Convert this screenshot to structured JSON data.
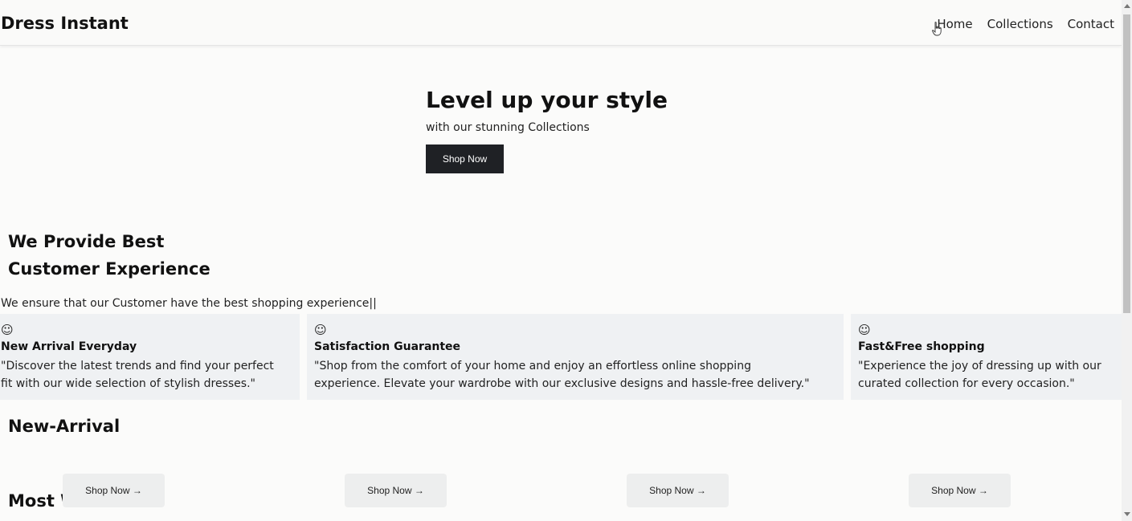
{
  "brand": "Dress Instant",
  "nav": {
    "home": "Home",
    "collections": "Collections",
    "contact": "Contact"
  },
  "hero": {
    "title": "Level up your style",
    "subtitle": "with our stunning Collections",
    "button": "Shop Now"
  },
  "experience": {
    "title_line1": "We Provide Best",
    "title_line2": "Customer Experience",
    "description": "We ensure that our Customer have the best shopping experience||"
  },
  "features": [
    {
      "icon": "☺",
      "title": "New Arrival Everyday",
      "line1": "\"Discover the latest trends and find your perfect",
      "line2": "fit with our wide selection of stylish dresses.\""
    },
    {
      "icon": "☺",
      "title": "Satisfaction Guarantee",
      "line1": "\"Shop from the comfort of your home and enjoy an effortless online shopping",
      "line2": "experience. Elevate your wardrobe with our exclusive designs and hassle-free delivery.\""
    },
    {
      "icon": "☺",
      "title": "Fast&Free shopping",
      "line1": "\"Experience the joy of dressing up with our",
      "line2": "curated collection for every occasion.\""
    }
  ],
  "new_arrival_title": "New-Arrival",
  "most_wanted_title": "Most Wanted",
  "product_buttons": [
    "Shop Now →",
    "Shop Now →",
    "Shop Now →",
    "Shop Now →"
  ],
  "icons": {
    "feature": "smiley-icon",
    "cursor": "hand-cursor-icon"
  }
}
